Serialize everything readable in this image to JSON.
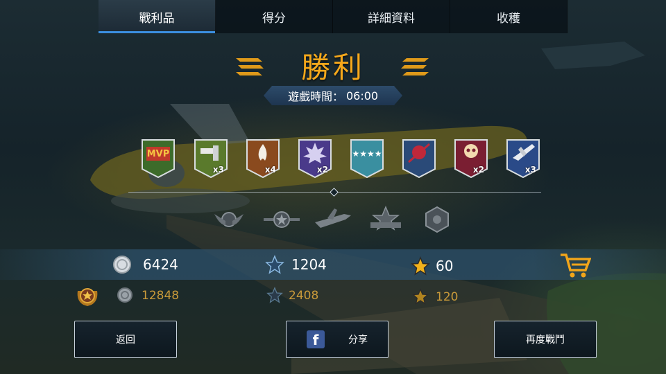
{
  "tabs": [
    {
      "label": "戰利品",
      "active": true
    },
    {
      "label": "得分",
      "active": false
    },
    {
      "label": "詳細資料",
      "active": false
    },
    {
      "label": "收穫",
      "active": false
    }
  ],
  "result": {
    "title": "勝利",
    "time_label": "遊戲時間：",
    "time_value": "06:00"
  },
  "medals": [
    {
      "icon": "mvp-medal-icon",
      "label": "MVP",
      "multiplier": ""
    },
    {
      "icon": "machine-gun-medal-icon",
      "multiplier": "x3"
    },
    {
      "icon": "fire-medal-icon",
      "multiplier": "x4"
    },
    {
      "icon": "explosion-medal-icon",
      "multiplier": "x2"
    },
    {
      "icon": "stars-medal-icon",
      "multiplier": ""
    },
    {
      "icon": "skull-crossed-medal-icon",
      "multiplier": ""
    },
    {
      "icon": "skull-medal-icon",
      "multiplier": "x2"
    },
    {
      "icon": "plane-medal-icon",
      "multiplier": "x3"
    }
  ],
  "rank_icons": [
    "wings-emblem-icon",
    "star-wings-icon",
    "airplane-icon",
    "star-banner-icon",
    "hexagon-badge-icon"
  ],
  "rewards": {
    "silver": "6424",
    "blue_stars": "1204",
    "gold_stars": "60",
    "bonus_silver": "12848",
    "bonus_blue_stars": "2408",
    "bonus_gold_stars": "120"
  },
  "buttons": {
    "back": "返回",
    "share": "分享",
    "again": "再度戰鬥"
  },
  "colors": {
    "title": "#f6a81b",
    "accent_tab": "#3b8fe0",
    "bonus_text": "#c99a3a",
    "facebook": "#3b5998"
  }
}
